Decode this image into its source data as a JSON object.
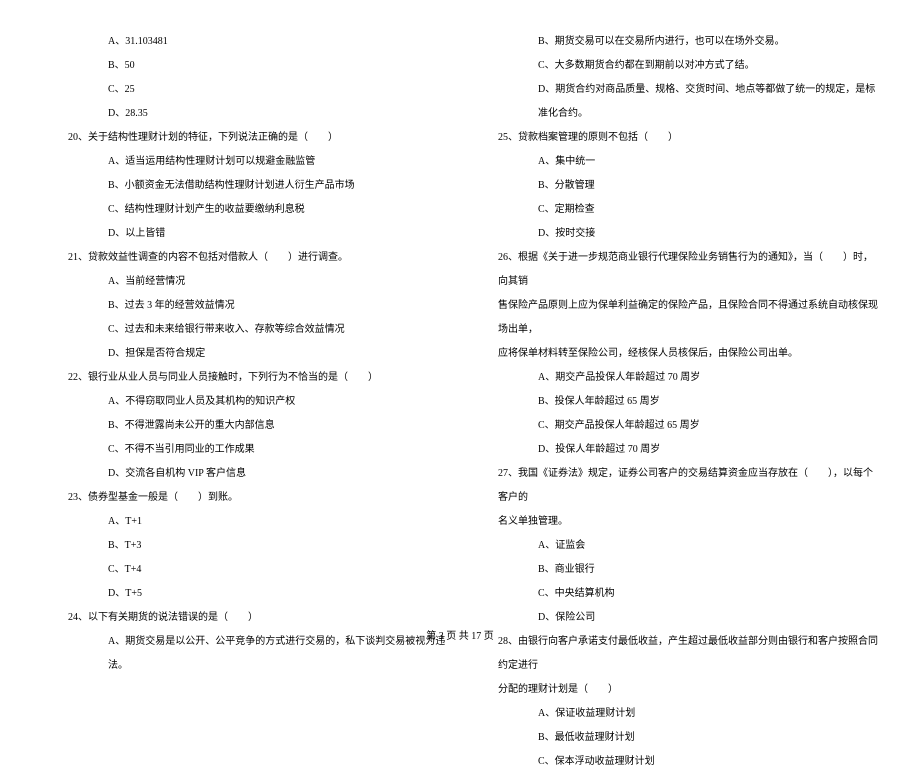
{
  "left_column": {
    "q19_options": [
      "A、31.103481",
      "B、50",
      "C、25",
      "D、28.35"
    ],
    "q20": "20、关于结构性理财计划的特征，下列说法正确的是（　　）",
    "q20_options": [
      "A、适当运用结构性理财计划可以规避金融监管",
      "B、小额资金无法借助结构性理财计划进人衍生产品市场",
      "C、结构性理财计划产生的收益要缴纳利息税",
      "D、以上皆错"
    ],
    "q21": "21、贷款效益性调查的内容不包括对借款人（　　）进行调查。",
    "q21_options": [
      "A、当前经营情况",
      "B、过去 3 年的经营效益情况",
      "C、过去和未来给银行带来收入、存款等综合效益情况",
      "D、担保是否符合规定"
    ],
    "q22": "22、银行业从业人员与同业人员接触时，下列行为不恰当的是（　　）",
    "q22_options": [
      "A、不得窃取同业人员及其机构的知识产权",
      "B、不得泄露尚未公开的重大内部信息",
      "C、不得不当引用同业的工作成果",
      "D、交流各自机构 VIP 客户信息"
    ],
    "q23": "23、债券型基金一般是（　　）到账。",
    "q23_options": [
      "A、T+1",
      "B、T+3",
      "C、T+4",
      "D、T+5"
    ],
    "q24": "24、以下有关期货的说法错误的是（　　）",
    "q24_options": [
      "A、期货交易是以公开、公平竞争的方式进行交易的，私下谈判交易被视为违法。"
    ]
  },
  "right_column": {
    "q24_options_cont": [
      "B、期货交易可以在交易所内进行，也可以在场外交易。",
      "C、大多数期货合约都在到期前以对冲方式了结。",
      "D、期货合约对商品质量、规格、交货时间、地点等都做了统一的规定，是标准化合约。"
    ],
    "q25": "25、贷款档案管理的原则不包括（　　）",
    "q25_options": [
      "A、集中统一",
      "B、分散管理",
      "C、定期检查",
      "D、按时交接"
    ],
    "q26": "26、根据《关于进一步规范商业银行代理保险业务销售行为的通知》，当（　　）时，向其销",
    "q26_cont1": "售保险产品原则上应为保单利益确定的保险产品，且保险合同不得通过系统自动核保现场出单，",
    "q26_cont2": "应将保单材料转至保险公司，经核保人员核保后，由保险公司出单。",
    "q26_options": [
      "A、期交产品投保人年龄超过 70 周岁",
      "B、投保人年龄超过 65 周岁",
      "C、期交产品投保人年龄超过 65 周岁",
      "D、投保人年龄超过 70 周岁"
    ],
    "q27": "27、我国《证券法》规定，证券公司客户的交易结算资金应当存放在（　　），以每个客户的",
    "q27_cont": "名义单独管理。",
    "q27_options": [
      "A、证监会",
      "B、商业银行",
      "C、中央结算机构",
      "D、保险公司"
    ],
    "q28": "28、由银行向客户承诺支付最低收益，产生超过最低收益部分则由银行和客户按照合同约定进行",
    "q28_cont": "分配的理财计划是（　　）",
    "q28_options": [
      "A、保证收益理财计划",
      "B、最低收益理财计划",
      "C、保本浮动收益理财计划"
    ]
  },
  "footer": "第 3 页 共 17 页"
}
